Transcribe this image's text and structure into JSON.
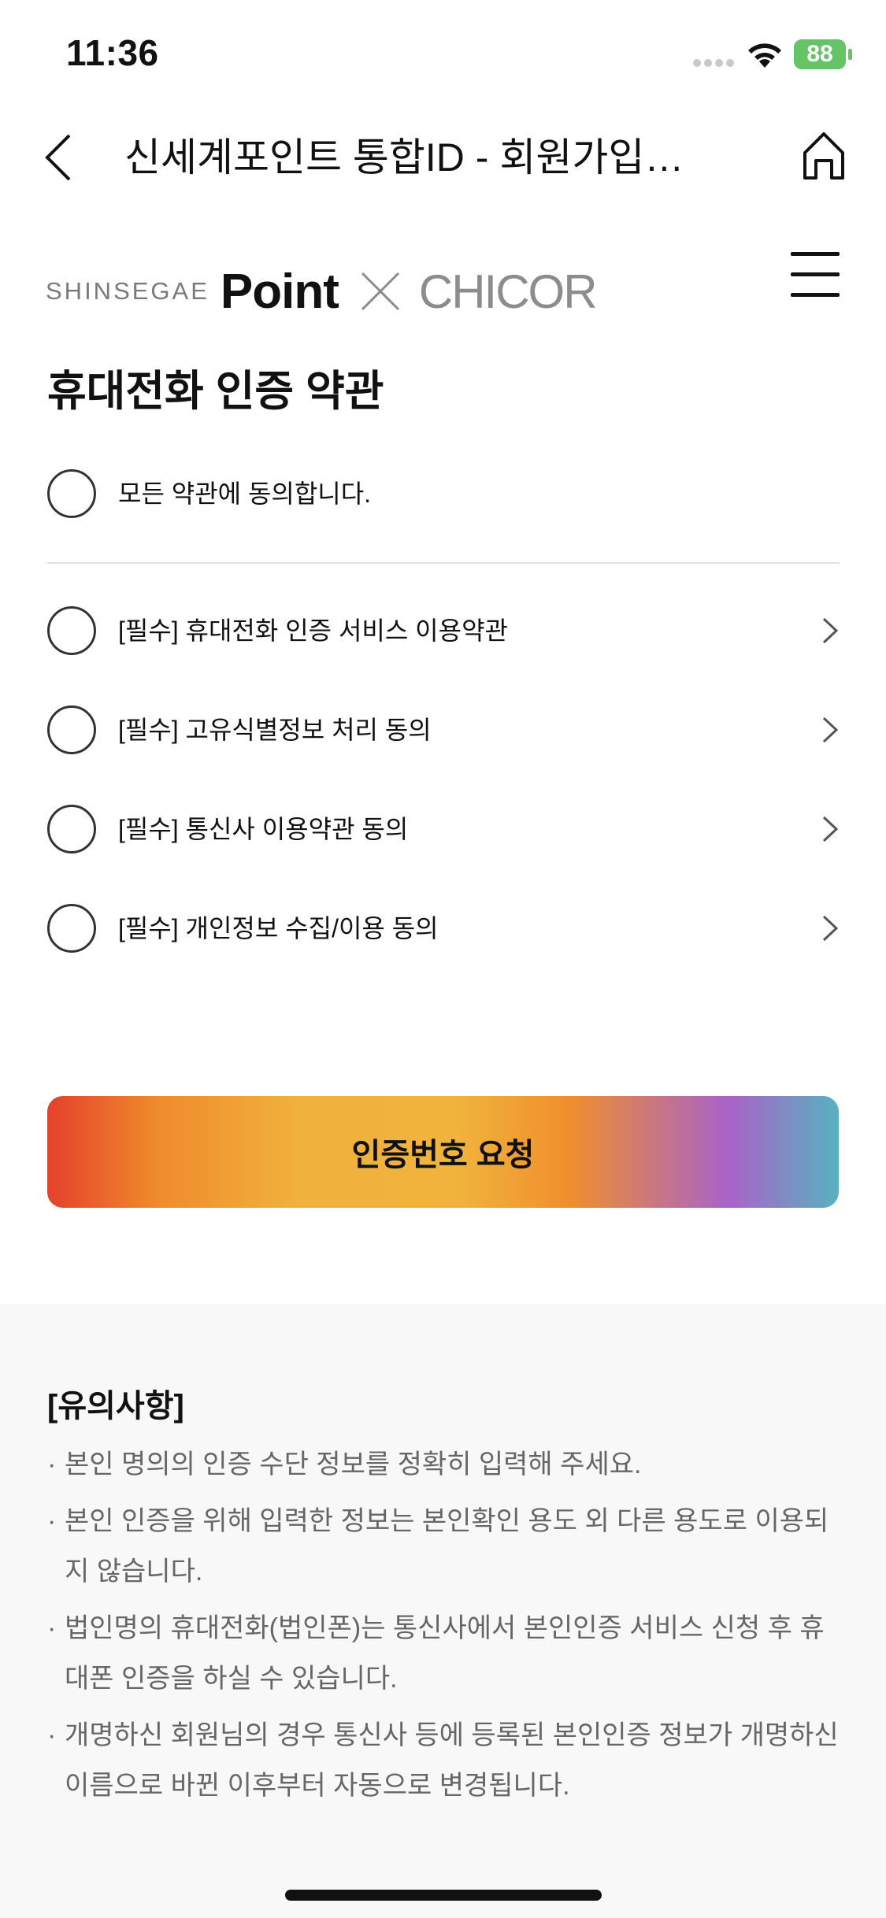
{
  "status_bar": {
    "time": "11:36",
    "battery": "88"
  },
  "nav": {
    "title": "신세계포인트 통합ID - 회원가입…"
  },
  "brand": {
    "shinsegae": "SHINSEGAE",
    "point": "Point",
    "partner": "CHICOR"
  },
  "terms": {
    "title": "휴대전화 인증 약관",
    "agree_all": "모든 약관에 동의합니다.",
    "items": [
      {
        "label": "[필수] 휴대전화 인증 서비스 이용약관"
      },
      {
        "label": "[필수] 고유식별정보 처리 동의"
      },
      {
        "label": "[필수] 통신사 이용약관 동의"
      },
      {
        "label": "[필수] 개인정보 수집/이용 동의"
      }
    ]
  },
  "request_button": "인증번호 요청",
  "notice": {
    "title": "[유의사항]",
    "items": [
      "본인 명의의 인증 수단 정보를 정확히 입력해 주세요.",
      "본인 인증을 위해 입력한 정보는 본인확인 용도 외 다른 용도로 이용되지 않습니다.",
      "법인명의 휴대전화(법인폰)는 통신사에서 본인인증 서비스 신청 후 휴대폰 인증을 하실 수 있습니다.",
      "개명하신 회원님의 경우 통신사 등에 등록된 본인인증 정보가 개명하신 이름으로 바뀐 이후부터 자동으로 변경됩니다."
    ]
  },
  "colors": {
    "battery": "#65c466",
    "gradient_start": "#e5412b",
    "gradient_mid": "#f1b33c",
    "gradient_purple": "#a963c8",
    "gradient_end": "#58b1c0"
  }
}
